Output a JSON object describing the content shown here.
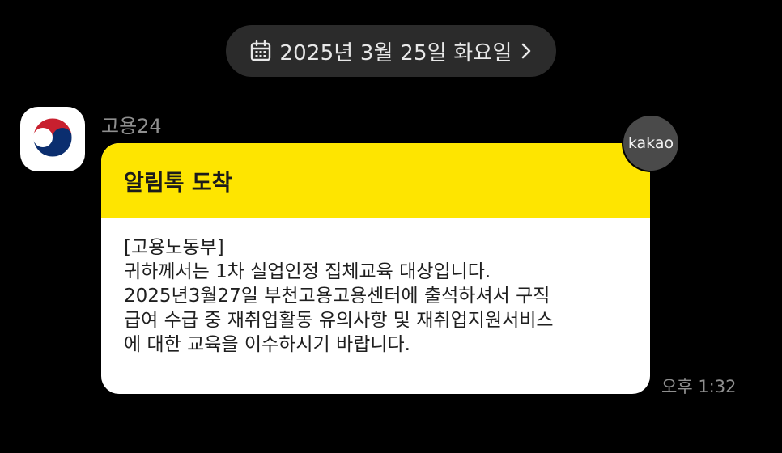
{
  "date_divider": {
    "icon": "calendar-icon",
    "text": "2025년 3월 25일 화요일",
    "chevron_icon": "chevron-right-icon"
  },
  "message": {
    "sender_name": "고용24",
    "avatar_icon": "korea-government-emblem-icon",
    "badge_text": "kakao",
    "header_color": "#fee500",
    "title": "알림톡 도착",
    "body_lines": [
      "[고용노동부]",
      "귀하께서는 1차 실업인정 집체교육 대상입니다.",
      "2025년3월27일 부천고용고용센터에 출석하셔서 구직",
      "급여 수급 중 재취업활동 유의사항 및 재취업지원서비스",
      "에 대한 교육을 이수하시기 바랍니다."
    ],
    "time": "오후 1:32"
  }
}
